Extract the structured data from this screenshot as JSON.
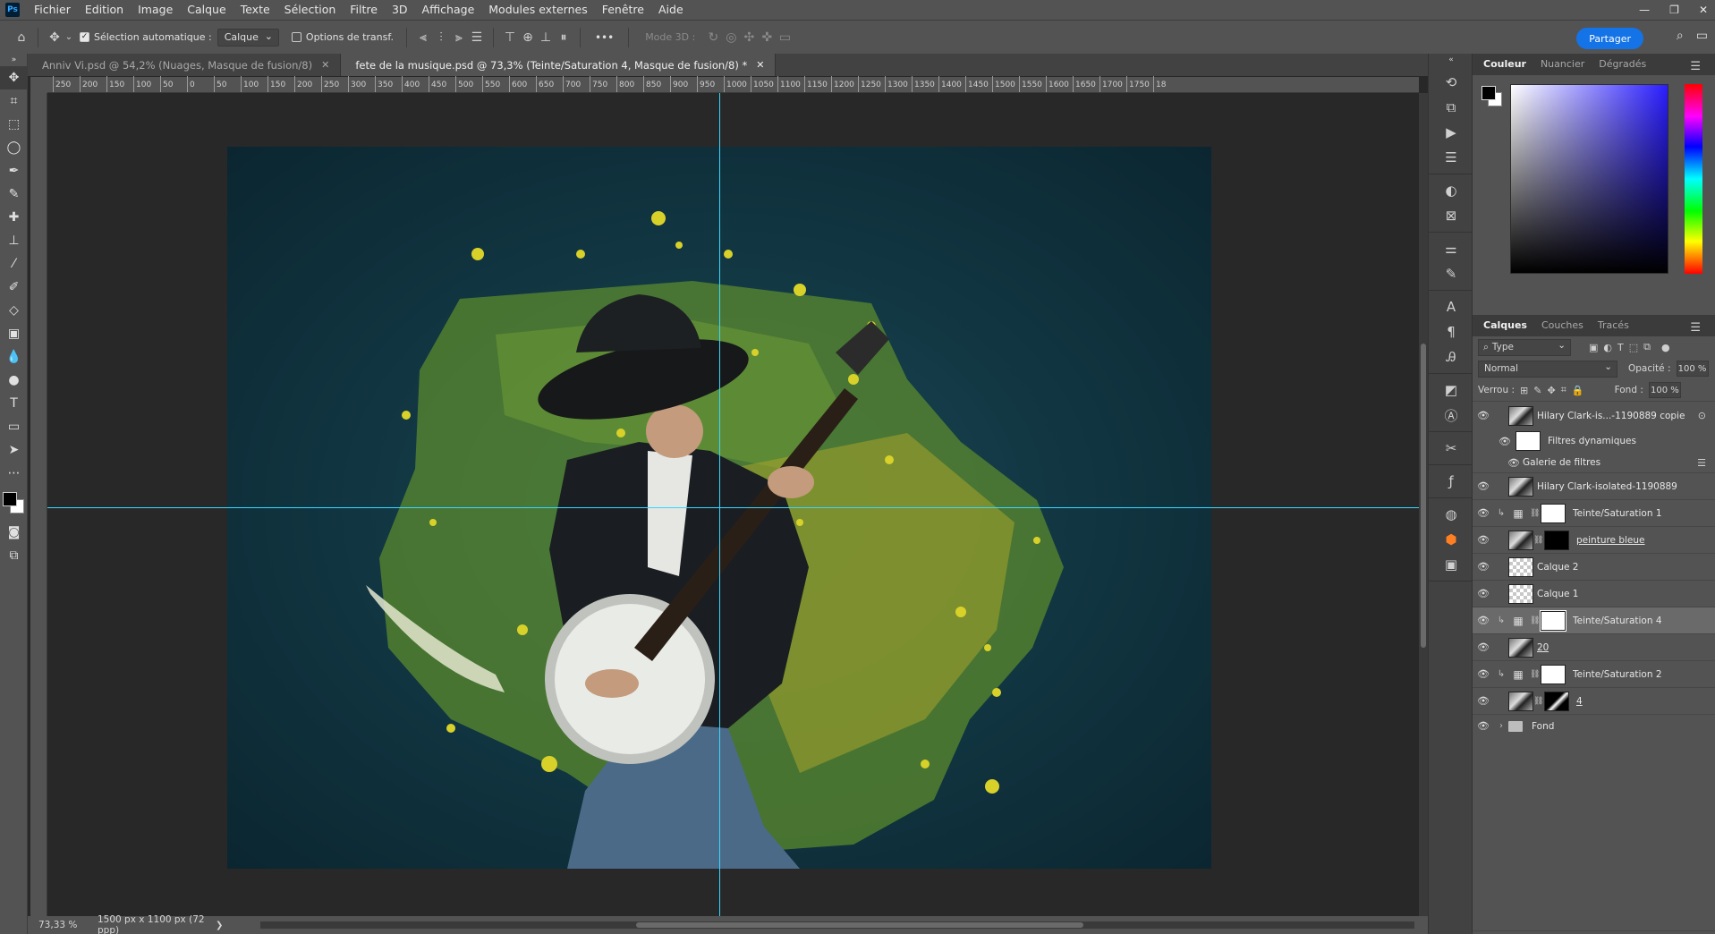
{
  "menu": [
    "Fichier",
    "Edition",
    "Image",
    "Calque",
    "Texte",
    "Sélection",
    "Filtre",
    "3D",
    "Affichage",
    "Modules externes",
    "Fenêtre",
    "Aide"
  ],
  "app_logo": "Ps",
  "options": {
    "auto_select_label": "Sélection automatique :",
    "auto_select_target": "Calque",
    "transform_label": "Options de transf.",
    "more_label": "•••",
    "mode3d_label": "Mode 3D :",
    "share_label": "Partager"
  },
  "tabs": [
    {
      "label": "Anniv Vi.psd @ 54,2% (Nuages, Masque de fusion/8)",
      "active": false
    },
    {
      "label": "fete de la musique.psd @ 73,3% (Teinte/Saturation 4, Masque de fusion/8) *",
      "active": true
    }
  ],
  "ruler_ticks": [
    "250",
    "200",
    "150",
    "100",
    "50",
    "0",
    "50",
    "100",
    "150",
    "200",
    "250",
    "300",
    "350",
    "400",
    "450",
    "500",
    "550",
    "600",
    "650",
    "700",
    "750",
    "800",
    "850",
    "900",
    "950",
    "1000",
    "1050",
    "1100",
    "1150",
    "1200",
    "1250",
    "1300",
    "1350",
    "1400",
    "1450",
    "1500",
    "1550",
    "1600",
    "1650",
    "1700",
    "1750",
    "18"
  ],
  "status": {
    "zoom": "73,33 %",
    "dimensions": "1500 px x 1100 px (72 ppp)"
  },
  "color_panel": {
    "tabs": [
      "Couleur",
      "Nuancier",
      "Dégradés"
    ]
  },
  "layers_panel": {
    "tabs": [
      "Calques",
      "Couches",
      "Tracés"
    ],
    "filter_label": "Type",
    "blend_mode": "Normal",
    "opacity_label": "Opacité :",
    "opacity_value": "100 %",
    "lock_label": "Verrou :",
    "fill_label": "Fond :",
    "fill_value": "100 %",
    "layers": [
      {
        "name": "Hilary Clark-is...-1190889 copie",
        "type": "smart",
        "selected": false
      },
      {
        "name": "Filtres dynamiques",
        "type": "smart-filters",
        "selected": false
      },
      {
        "name": "Galerie de filtres",
        "type": "filter",
        "selected": false
      },
      {
        "name": "Hilary Clark-isolated-1190889",
        "type": "image",
        "selected": false
      },
      {
        "name": "Teinte/Saturation 1",
        "type": "adjustment",
        "selected": false
      },
      {
        "name": "peinture bleue",
        "type": "masked-image",
        "selected": false
      },
      {
        "name": "Calque 2",
        "type": "pixel",
        "selected": false
      },
      {
        "name": "Calque 1",
        "type": "pixel",
        "selected": false
      },
      {
        "name": "Teinte/Saturation 4",
        "type": "adjustment",
        "selected": true
      },
      {
        "name": "20",
        "type": "image",
        "selected": false
      },
      {
        "name": "Teinte/Saturation 2",
        "type": "adjustment",
        "selected": false
      },
      {
        "name": "4",
        "type": "masked-image",
        "selected": false
      },
      {
        "name": "Fond",
        "type": "group",
        "selected": false
      }
    ]
  },
  "window_controls": [
    "—",
    "❐",
    "✕"
  ]
}
